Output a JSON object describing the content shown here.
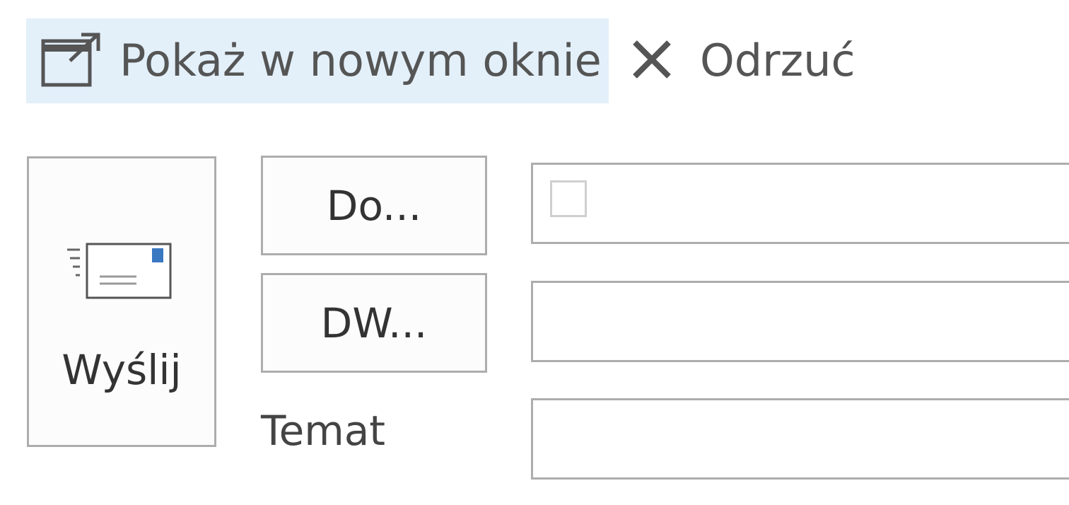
{
  "toolbar": {
    "pop_out": {
      "label": "Pokaż w nowym oknie",
      "icon": "pop-out-icon"
    },
    "discard": {
      "label": "Odrzuć",
      "icon": "close-icon"
    }
  },
  "compose": {
    "send": {
      "label": "Wyślij",
      "icon": "envelope-send-icon"
    },
    "to": {
      "label": "Do...",
      "value": ""
    },
    "cc": {
      "label": "DW...",
      "value": ""
    },
    "subject": {
      "label": "Temat",
      "value": ""
    }
  },
  "colors": {
    "highlight": "#e3f0fa",
    "border": "#adadad",
    "text": "#444444",
    "accent": "#3a78c2"
  }
}
